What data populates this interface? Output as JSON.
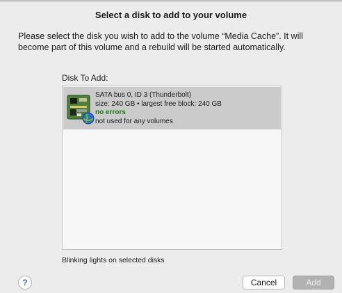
{
  "dialog": {
    "title": "Select a disk to add to your volume",
    "message": "Please select the disk you wish to add to the volume “Media Cache”.  It will become part of this volume and a rebuild will be started automatically."
  },
  "disk_list": {
    "label": "Disk To Add:",
    "items": [
      {
        "name": "SATA bus 0, ID 3 (Thunderbolt)",
        "size": "size: 240 GB • largest free block: 240 GB",
        "status": "no errors",
        "usage": "not used for any volumes",
        "icon": "hard-drive-icon"
      }
    ]
  },
  "blink_label": "Blinking lights on selected disks",
  "buttons": {
    "help": "?",
    "cancel": "Cancel",
    "add": "Add"
  },
  "colors": {
    "status_ok": "#1d7a1d",
    "selection": "#cbcbcb",
    "help_accent": "#1f6fd6"
  }
}
